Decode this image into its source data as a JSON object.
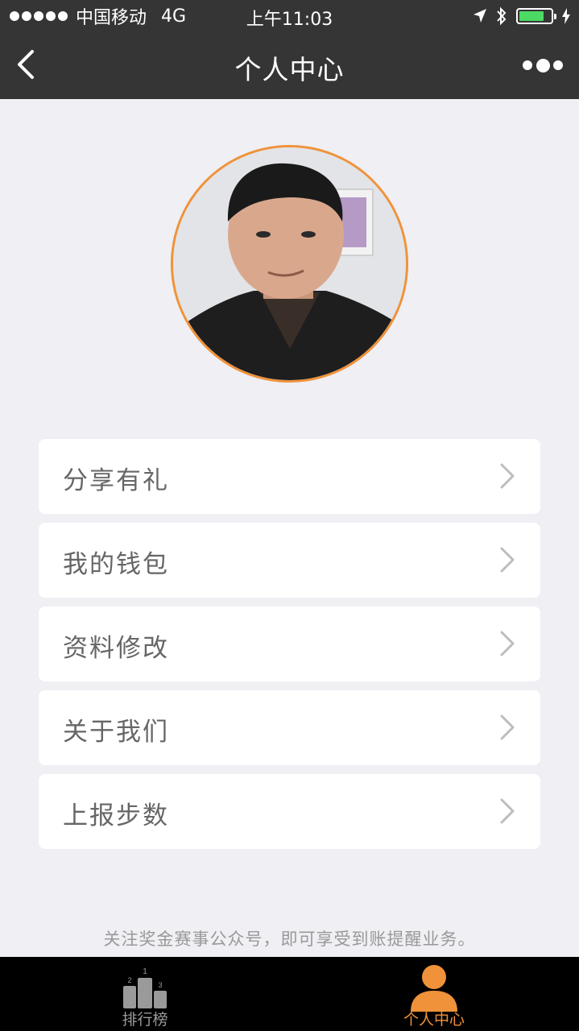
{
  "status_bar": {
    "carrier": "中国移动",
    "network": "4G",
    "time": "上午11:03",
    "battery_color": "#4cd964"
  },
  "navbar": {
    "title": "个人中心",
    "back_icon": "chevron-left-icon",
    "more_icon": "more-dots-icon"
  },
  "profile": {
    "avatar_border_color": "#f0923a"
  },
  "menu": {
    "items": [
      {
        "label": "分享有礼"
      },
      {
        "label": "我的钱包"
      },
      {
        "label": "资料修改"
      },
      {
        "label": "关于我们"
      },
      {
        "label": "上报步数"
      }
    ]
  },
  "footer_note": "关注奖金赛事公众号，即可享受到账提醒业务。",
  "tabbar": {
    "tabs": [
      {
        "label": "排行榜",
        "icon": "podium-icon",
        "active": false,
        "podium_numbers": [
          "1",
          "2",
          "3"
        ]
      },
      {
        "label": "个人中心",
        "icon": "user-icon",
        "active": true
      }
    ],
    "active_color": "#f0923a"
  }
}
